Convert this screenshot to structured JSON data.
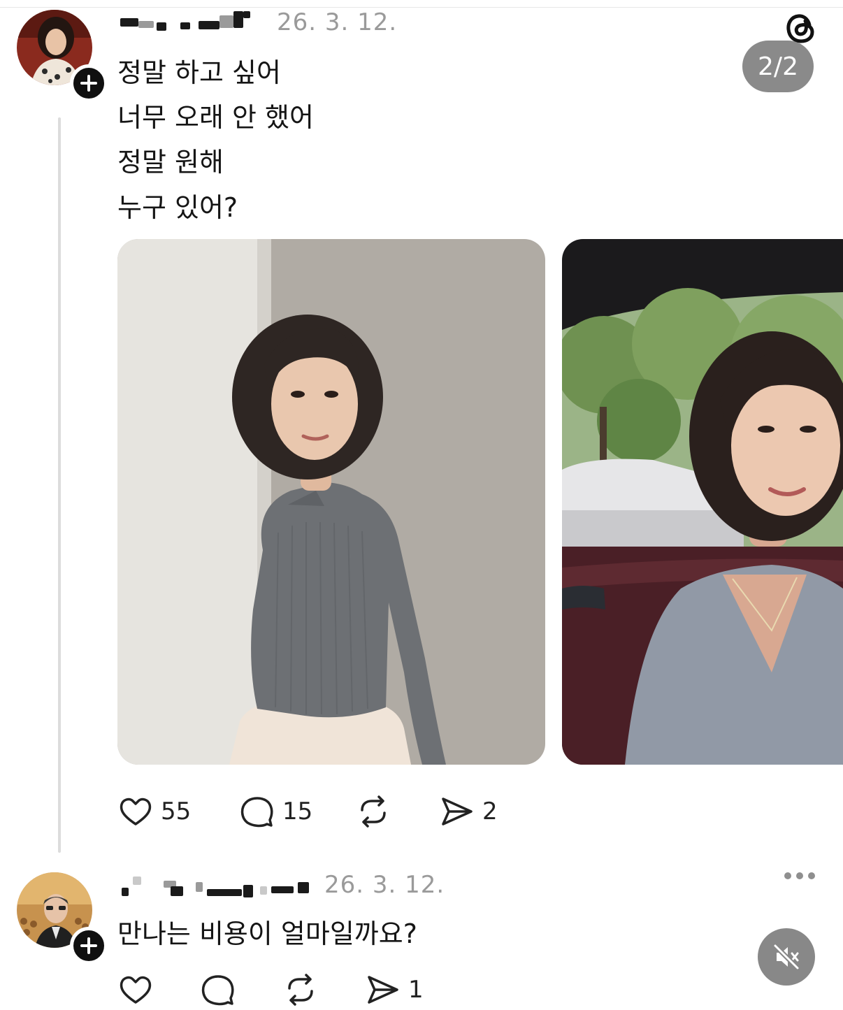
{
  "post": {
    "timestamp": "26. 3. 12.",
    "lines": [
      "정말 하고 싶어",
      "너무 오래 안 했어",
      "정말 원해",
      "누구 있어?"
    ],
    "carousel_counter": "2/2",
    "images": [
      "photo-woman-grey-sweater",
      "photo-woman-in-car"
    ],
    "actions": {
      "likes": "55",
      "replies": "15",
      "shares": "2"
    }
  },
  "reply": {
    "timestamp": "26. 3. 12.",
    "text": "만나는 비용이 얼마일까요?",
    "actions": {
      "shares": "1"
    }
  },
  "colors": {
    "muted_text": "#9a9a9a",
    "pill_bg": "#8a8a8a",
    "badge_bg": "#101010"
  },
  "icons": [
    "threads-logo-icon",
    "plus-icon",
    "heart-icon",
    "comment-icon",
    "repost-icon",
    "send-icon",
    "more-icon",
    "mute-icon"
  ]
}
